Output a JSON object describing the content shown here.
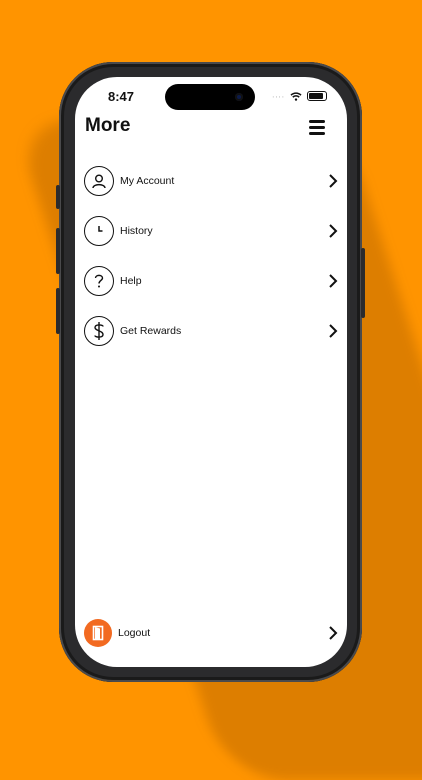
{
  "status_bar": {
    "time": "8:47",
    "signal_dots": "∙∙∙∙"
  },
  "header": {
    "title": "More",
    "menu_icon": "hamburger-icon"
  },
  "menu": {
    "items": [
      {
        "label": "My Account",
        "icon": "user-icon"
      },
      {
        "label": "History",
        "icon": "clock-icon"
      },
      {
        "label": "Help",
        "icon": "question-icon"
      },
      {
        "label": "Get Rewards",
        "icon": "dollar-icon"
      }
    ]
  },
  "logout": {
    "label": "Logout",
    "icon": "door-icon"
  },
  "colors": {
    "background": "#FF9400",
    "accent": "#F26A21"
  }
}
